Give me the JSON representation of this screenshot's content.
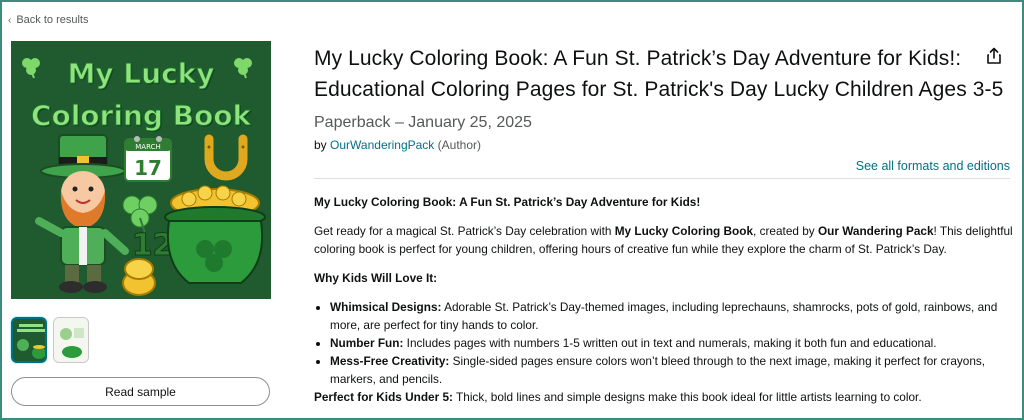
{
  "nav": {
    "back_label": "Back to results"
  },
  "cover": {
    "title_line1": "My Lucky",
    "title_line2": "Coloring Book",
    "calendar_month": "MARCH",
    "calendar_day": "17",
    "numbers": "123"
  },
  "sample": {
    "read_sample_label": "Read sample"
  },
  "product": {
    "title": "My Lucky Coloring Book: A Fun St. Patrick’s Day Adventure for Kids!: Educational Coloring Pages for St. Patrick's Day Lucky Children Ages 3-5",
    "format": "Paperback – January 25, 2025",
    "by": "by",
    "author": "OurWanderingPack",
    "author_role": "(Author)",
    "see_all": "See all formats and editions"
  },
  "description": {
    "heading": "My Lucky Coloring Book: A Fun St. Patrick’s Day Adventure for Kids!",
    "intro_1": "Get ready for a magical St. Patrick’s Day celebration with ",
    "intro_bold_1": "My Lucky Coloring Book",
    "intro_2": ", created by ",
    "intro_bold_2": "Our Wandering Pack",
    "intro_3": "! This delightful coloring book is perfect for young children, offering hours of creative fun while they explore the charm of St. Patrick’s Day.",
    "why_heading": "Why Kids Will Love It:",
    "bullets": [
      {
        "label": "Whimsical Designs:",
        "text": " Adorable St. Patrick’s Day-themed images, including leprechauns, shamrocks, pots of gold, rainbows, and more, are perfect for tiny hands to color."
      },
      {
        "label": "Number Fun:",
        "text": " Includes pages with numbers 1-5 written out in text and numerals, making it both fun and educational."
      },
      {
        "label": "Mess-Free Creativity:",
        "text": " Single-sided pages ensure colors won’t bleed through to the next image, making it perfect for crayons, markers, and pencils."
      }
    ],
    "perfect_label": "Perfect for Kids Under 5:",
    "perfect_text": " Thick, bold lines and simple designs make this book ideal for little artists learning to color."
  },
  "colors": {
    "link": "#007185",
    "cover_bg": "#1f5b2f",
    "cover_title": "#8fe37c",
    "text": "#0f1111",
    "muted": "#565959"
  },
  "icons": [
    "chevron-left-icon",
    "share-icon",
    "shamrock-icon",
    "horseshoe-icon",
    "calendar-icon",
    "pot-of-gold-icon",
    "leprechaun-icon"
  ]
}
